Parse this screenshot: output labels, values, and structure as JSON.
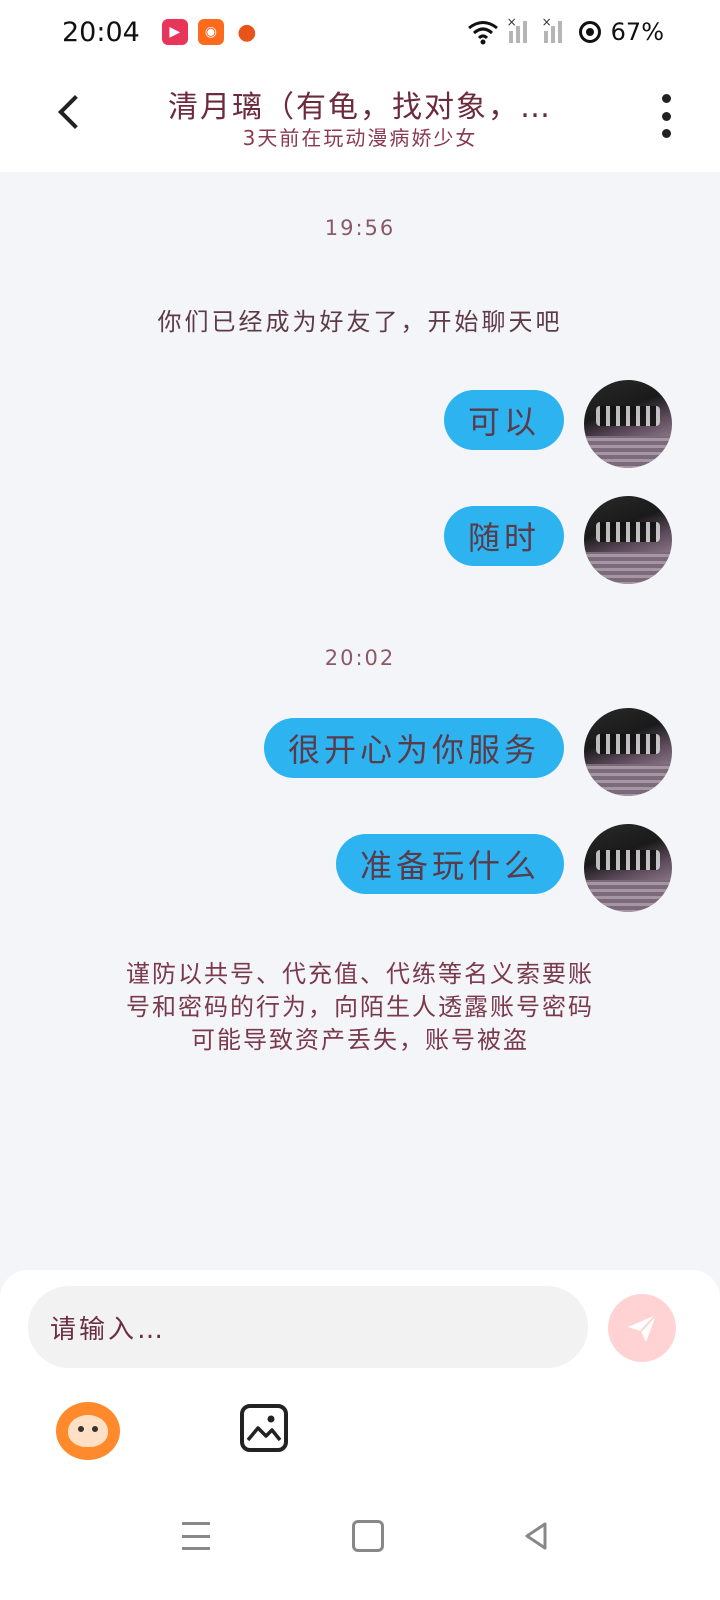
{
  "status_bar": {
    "time": "20:04",
    "battery": "67%",
    "app_icons": [
      "video-app-icon",
      "kuaishou-icon",
      "game-icon"
    ]
  },
  "header": {
    "title": "清月璃（有龟，找对象，…",
    "subtitle": "3天前在玩动漫病娇少女"
  },
  "chat": {
    "timestamp_1": "19:56",
    "system_message": "你们已经成为好友了，开始聊天吧",
    "messages_1": [
      {
        "text": "可以",
        "from": "self"
      },
      {
        "text": "随时",
        "from": "self"
      }
    ],
    "timestamp_2": "20:02",
    "messages_2": [
      {
        "text": "很开心为你服务",
        "from": "self"
      },
      {
        "text": "准备玩什么",
        "from": "self"
      }
    ],
    "warning_lines": [
      "谨防以共号、代充值、代练等名义索要账",
      "号和密码的行为，向陌生人透露账号密码",
      "可能导致资产丢失，账号被盗"
    ]
  },
  "input": {
    "placeholder": "请输入…"
  },
  "colors": {
    "bubble": "#2db3f0",
    "chat_bg": "#f3f5f8",
    "send_btn": "#ffd3d3",
    "text_accent": "#6b2a3e"
  },
  "icons": {
    "back": "back-arrow-icon",
    "more": "more-vertical-icon",
    "send": "send-icon",
    "emoji": "emoji-icon",
    "image": "image-icon"
  }
}
